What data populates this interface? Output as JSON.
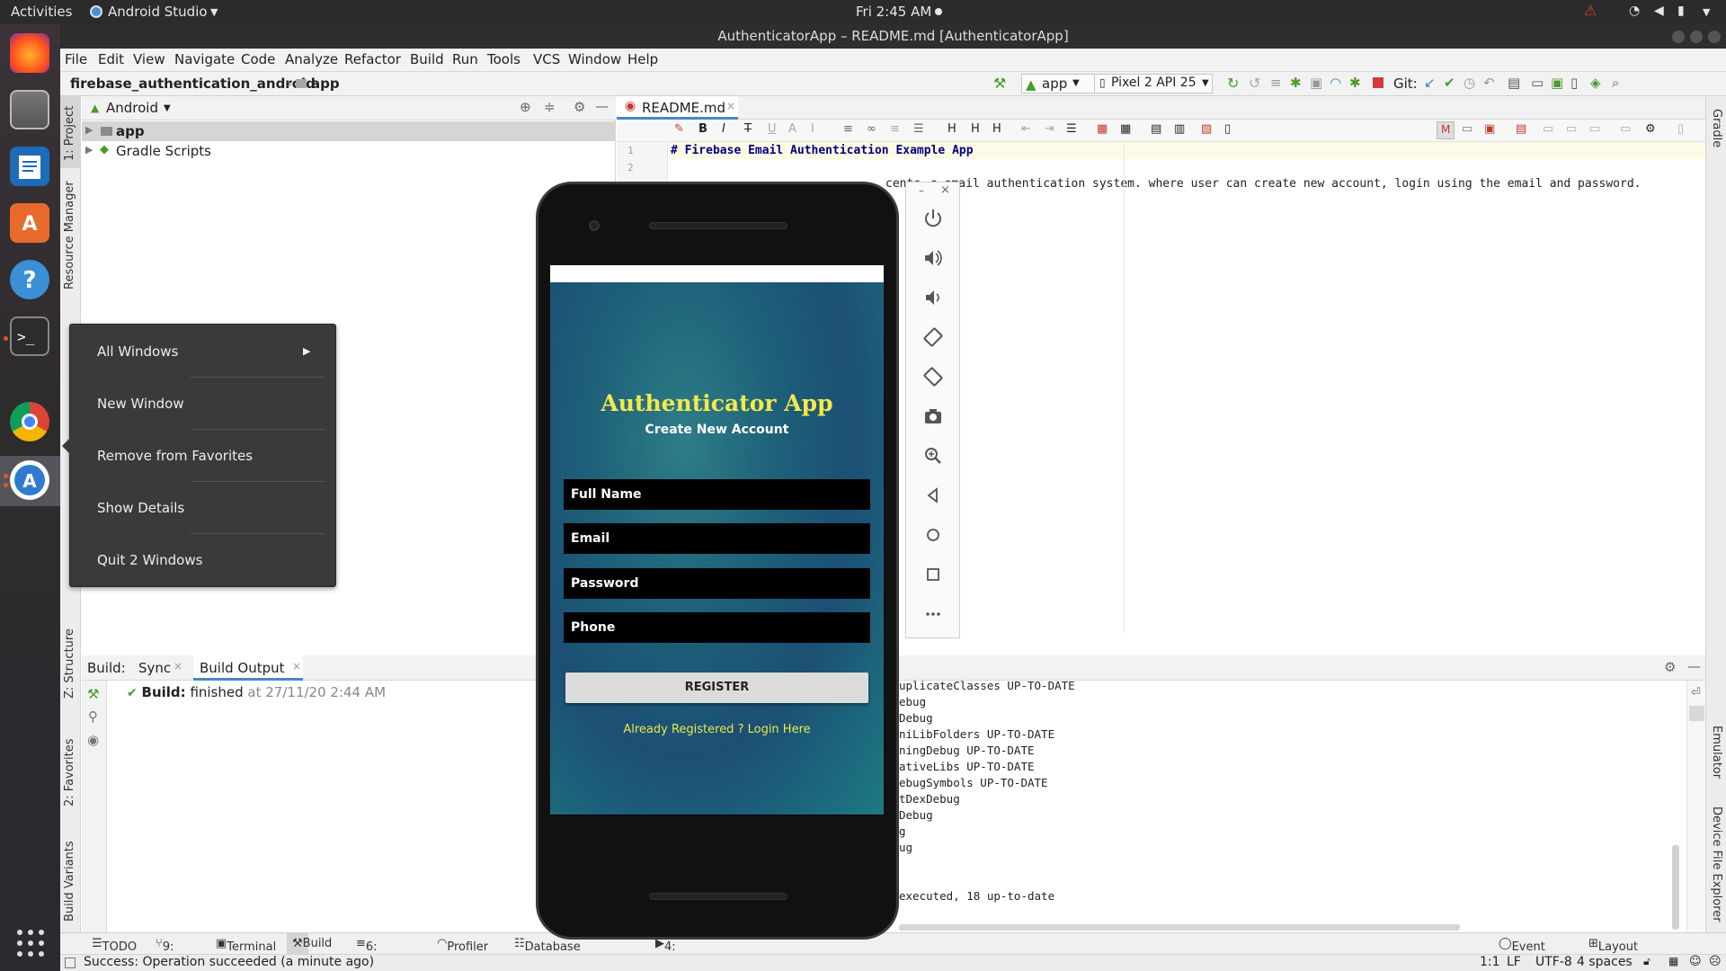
{
  "topbar": {
    "activities": "Activities",
    "app_name": "Android Studio",
    "clock": "Fri  2:45 AM"
  },
  "window": {
    "title": "AuthenticatorApp – README.md [AuthenticatorApp]"
  },
  "menu": [
    "File",
    "Edit",
    "View",
    "Navigate",
    "Code",
    "Analyze",
    "Refactor",
    "Build",
    "Run",
    "Tools",
    "VCS",
    "Window",
    "Help"
  ],
  "nav": {
    "project": "firebase_authentication_android",
    "module": "app",
    "run_config": "app",
    "device": "Pixel 2 API 25",
    "git_label": "Git:"
  },
  "left_strip": {
    "project": "1: Project",
    "resource_manager": "Resource Manager",
    "structure": "Z: Structure",
    "favorites": "2: Favorites",
    "build_variants": "Build Variants"
  },
  "right_strip": {
    "gradle": "Gradle",
    "emulator": "Emulator",
    "device_file_explorer": "Device File Explorer"
  },
  "project_panel": {
    "view": "Android",
    "items": [
      "app",
      "Gradle Scripts"
    ]
  },
  "editor": {
    "tab": "README.md",
    "lines": [
      {
        "num": "1",
        "text": "# Firebase Email Authentication Example App"
      },
      {
        "num": "2",
        "text": ""
      }
    ],
    "line3_tail": "e email authentication system. where user can create new account, login using the email and password.",
    "line3_prefix": "cente"
  },
  "build": {
    "label": "Build:",
    "tabs": [
      "Sync",
      "Build Output"
    ],
    "status_bold": "Build:",
    "status_text": "finished",
    "status_time": "at 27/11/20 2:44 AM",
    "log": [
      "uplicateClasses UP-TO-DATE",
      "ebug",
      "Debug",
      "niLibFolders UP-TO-DATE",
      "ningDebug UP-TO-DATE",
      "ativeLibs UP-TO-DATE",
      "ebugSymbols UP-TO-DATE",
      "tDexDebug",
      "Debug",
      "g",
      "ug",
      "",
      "",
      "executed, 18 up-to-date"
    ]
  },
  "bottom_tabs": [
    "TODO",
    "9: Git",
    "Terminal",
    "Build",
    "6: Logcat",
    "Profiler",
    "Database Inspector",
    "4: Run",
    "Event Log",
    "Layout Inspector"
  ],
  "status": {
    "message": "Success: Operation succeeded (a minute ago)",
    "pos": "1:1",
    "lf": "LF",
    "enc": "UTF-8",
    "indent": "4 spaces"
  },
  "context_menu": [
    "All Windows",
    "New Window",
    "Remove from Favorites",
    "Show Details",
    "Quit 2 Windows"
  ],
  "phone_app": {
    "title": "Authenticator App",
    "subtitle": "Create New Account",
    "fields": [
      "Full Name",
      "Email",
      "Password",
      "Phone"
    ],
    "button": "REGISTER",
    "login_link": "Already Registered ? Login Here",
    "title_color": "#f5e84a",
    "link_color": "#e8e84a"
  }
}
